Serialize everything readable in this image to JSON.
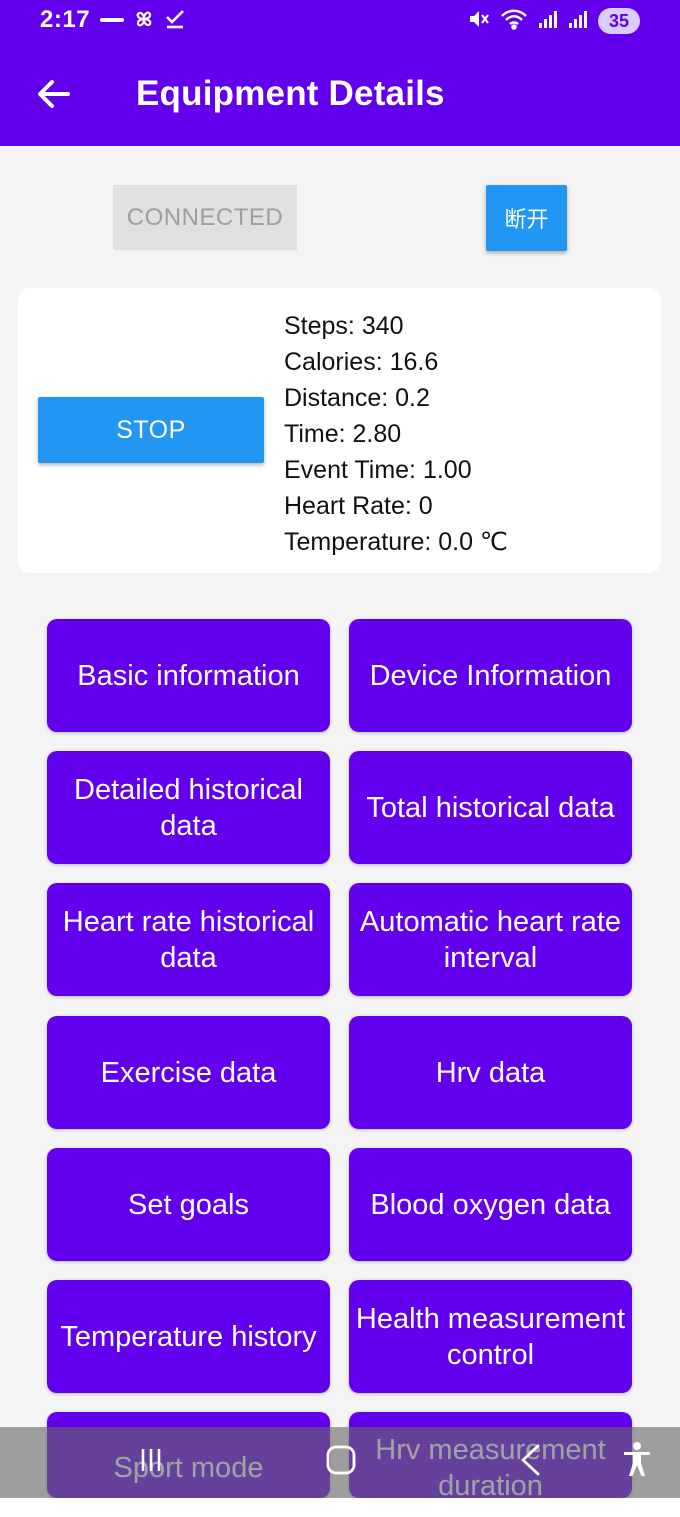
{
  "status_bar": {
    "time": "2:17",
    "notification_icons": [
      "zomato-icon",
      "pinwheel-icon",
      "check-icon"
    ],
    "right_icons": [
      "mute-icon",
      "wifi-icon",
      "signal-icon",
      "signal-icon"
    ],
    "battery": "35"
  },
  "header": {
    "title": "Equipment Details",
    "background": "#6200ee"
  },
  "connection": {
    "connected_label": "CONNECTED",
    "disconnect_label": "断开"
  },
  "stats": {
    "stop_label": "STOP",
    "lines": [
      "Steps: 340",
      "Calories: 16.6",
      "Distance: 0.2",
      "Time: 2.80",
      "Event Time: 1.00",
      "Heart Rate: 0",
      "Temperature: 0.0 ℃"
    ]
  },
  "functions": [
    "Basic information",
    "Device Information",
    "Detailed historical data",
    "Total historical data",
    "Heart rate historical data",
    "Automatic heart rate interval",
    "Exercise data",
    "Hrv data",
    "Set goals",
    "Blood oxygen data",
    "Temperature history",
    "Health measurement control",
    "Sport mode",
    "Hrv measurement duration"
  ],
  "nav": {
    "items": [
      "recents-icon",
      "home-icon",
      "back-icon",
      "accessibility-icon"
    ]
  },
  "colors": {
    "primary": "#6200ee",
    "button_blue": "#2196f3",
    "disabled": "#e0e0e0"
  }
}
